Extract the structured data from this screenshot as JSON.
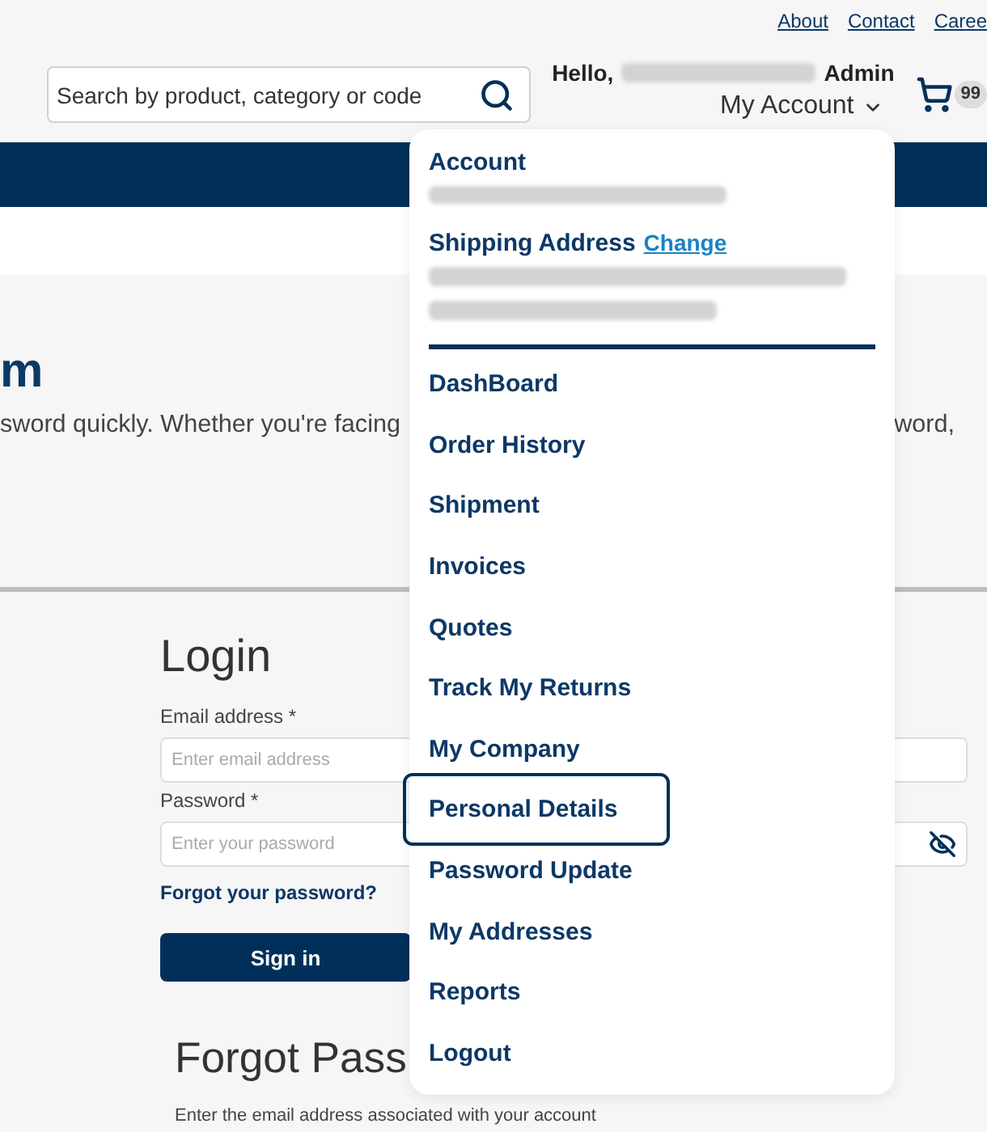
{
  "top_links": [
    {
      "label": "About"
    },
    {
      "label": "Contact"
    },
    {
      "label": "Caree"
    }
  ],
  "search": {
    "placeholder": "Search by product, category or code"
  },
  "greeting": {
    "prefix": "Hello,",
    "name_redacted": true,
    "role": "Admin"
  },
  "account_menu": {
    "label": "My Account",
    "expanded": true,
    "dropdown": {
      "account_label": "Account",
      "account_redacted": true,
      "shipping_label": "Shipping Address",
      "shipping_link": "Change",
      "address_lines": [
        {
          "redacted": true
        },
        {
          "redacted": true
        }
      ],
      "items": [
        {
          "label": "DashBoard",
          "focused": false
        },
        {
          "label": "Order History",
          "focused": false
        },
        {
          "label": "Shipment",
          "focused": false
        },
        {
          "label": "Invoices",
          "focused": false
        },
        {
          "label": "Quotes",
          "focused": false
        },
        {
          "label": "Track My Returns",
          "focused": false
        },
        {
          "label": "My Company",
          "focused": false
        },
        {
          "label": "Personal Details",
          "focused": true
        },
        {
          "label": "Password Update",
          "focused": false
        },
        {
          "label": "My Addresses",
          "focused": false
        },
        {
          "label": "Reports",
          "focused": false
        },
        {
          "label": "Logout",
          "focused": false
        }
      ]
    }
  },
  "cart": {
    "badge": "99"
  },
  "hero": {
    "heading": "m",
    "text_left": "sword quickly. Whether you're facing",
    "text_right": "word,"
  },
  "login": {
    "title": "Login",
    "fields": [
      {
        "kind": "email",
        "label": "Email address *",
        "placeholder": "Enter email address"
      },
      {
        "kind": "password",
        "label": "Password *",
        "placeholder": "Enter your password"
      }
    ],
    "forgot_link": "Forgot your password?",
    "submit": "Sign in"
  },
  "forgot_password": {
    "title": "Forgot Pass",
    "text": "Enter the email address associated with your account"
  }
}
